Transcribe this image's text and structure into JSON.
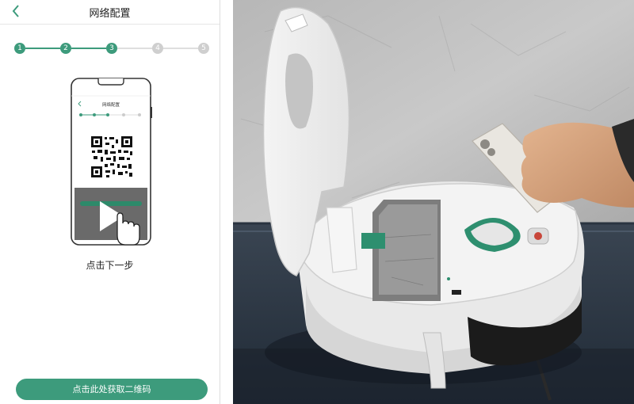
{
  "app": {
    "title": "网络配置",
    "steps": [
      {
        "label": "1",
        "state": "done"
      },
      {
        "label": "2",
        "state": "done"
      },
      {
        "label": "3",
        "state": "done"
      },
      {
        "label": "4",
        "state": "todo"
      },
      {
        "label": "5",
        "state": "todo"
      }
    ],
    "illustration": {
      "mini_title": "网络配置"
    },
    "hint": "点击下一步",
    "cta_label": "点击此处获取二维码"
  },
  "colors": {
    "accent": "#3d9b7c",
    "inactive": "#cfcfcf",
    "robot_accent": "#2e8f6f"
  },
  "icons": [
    "chevron-left-icon",
    "play-icon",
    "hand-pointer-icon",
    "qr-code-icon",
    "smartphone-icon"
  ]
}
